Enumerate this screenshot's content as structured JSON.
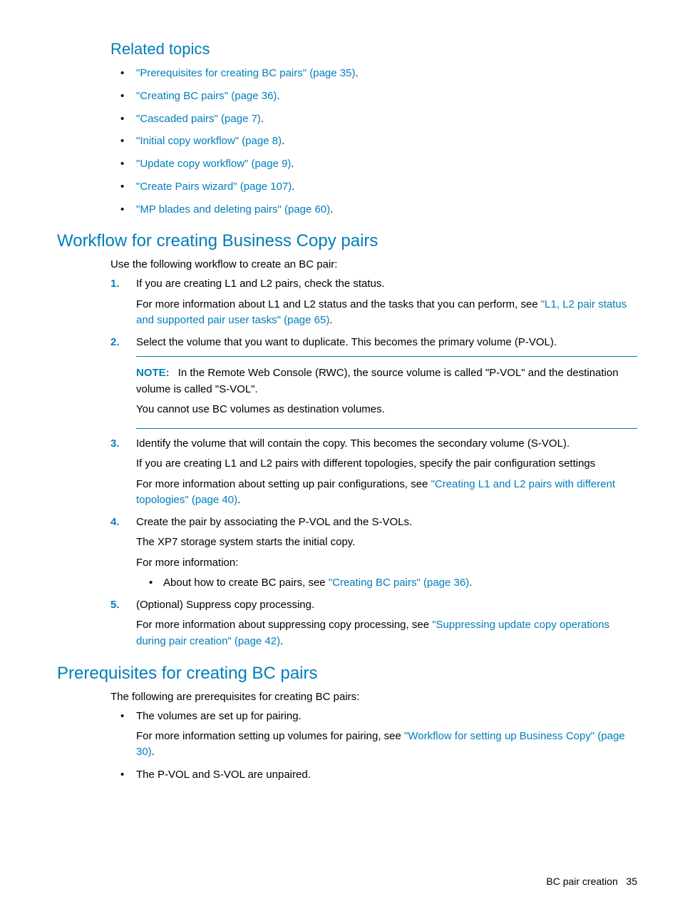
{
  "related": {
    "heading": "Related topics",
    "items": [
      {
        "link": "\"Prerequisites for creating BC pairs\" (page 35)",
        "suffix": "."
      },
      {
        "link": "\"Creating BC pairs\" (page 36)",
        "suffix": "."
      },
      {
        "link": "\"Cascaded pairs\" (page 7)",
        "suffix": "."
      },
      {
        "link": "\"Initial copy workflow\" (page 8)",
        "suffix": "."
      },
      {
        "link": "\"Update copy workflow\" (page 9)",
        "suffix": "."
      },
      {
        "link": "\"Create Pairs wizard\" (page 107)",
        "suffix": "."
      },
      {
        "link": "\"MP blades and deleting pairs\" (page 60)",
        "suffix": "."
      }
    ]
  },
  "workflow": {
    "heading": "Workflow for creating Business Copy pairs",
    "intro": "Use the following workflow to create an BC pair:",
    "step1": {
      "num": "1.",
      "line1": "If you are creating L1 and L2 pairs, check the status.",
      "line2_pre": "For more information about L1 and L2 status and the tasks that you can perform, see ",
      "line2_link": "\"L1, L2 pair status and supported pair user tasks\" (page 65)",
      "line2_post": "."
    },
    "step2": {
      "num": "2.",
      "line1": "Select the volume that you want to duplicate. This becomes the primary volume (P-VOL).",
      "note_label": "NOTE:",
      "note_text": "In the Remote Web Console (RWC), the source volume is called \"P-VOL\" and the destination volume is called \"S-VOL\".",
      "note_text2": "You cannot use BC volumes as destination volumes."
    },
    "step3": {
      "num": "3.",
      "line1": "Identify the volume that will contain the copy. This becomes the secondary volume (S-VOL).",
      "line2": "If you are creating L1 and L2 pairs with different topologies, specify the pair configuration settings",
      "line3_pre": "For more information about setting up pair configurations, see ",
      "line3_link": "\"Creating L1 and L2 pairs with different topologies\" (page 40)",
      "line3_post": "."
    },
    "step4": {
      "num": "4.",
      "line1": "Create the pair by associating the P-VOL and the S-VOLs.",
      "line2": "The XP7 storage system starts the initial copy.",
      "line3": "For more information:",
      "sub_pre": "About how to create BC pairs, see ",
      "sub_link": "\"Creating BC pairs\" (page 36)",
      "sub_post": "."
    },
    "step5": {
      "num": "5.",
      "line1": "(Optional) Suppress copy processing.",
      "line2_pre": "For more information about suppressing copy processing, see ",
      "line2_link": "\"Suppressing update copy operations during pair creation\" (page 42)",
      "line2_post": "."
    }
  },
  "prereq": {
    "heading": "Prerequisites for creating BC pairs",
    "intro": "The following are prerequisites for creating BC pairs:",
    "item1_line1": "The volumes are set up for pairing.",
    "item1_line2_pre": "For more information setting up volumes for pairing, see ",
    "item1_line2_link": "\"Workflow for setting up Business Copy\" (page 30)",
    "item1_line2_post": ".",
    "item2": "The P-VOL and S-VOL are unpaired."
  },
  "footer": {
    "section": "BC pair creation",
    "page": "35"
  }
}
